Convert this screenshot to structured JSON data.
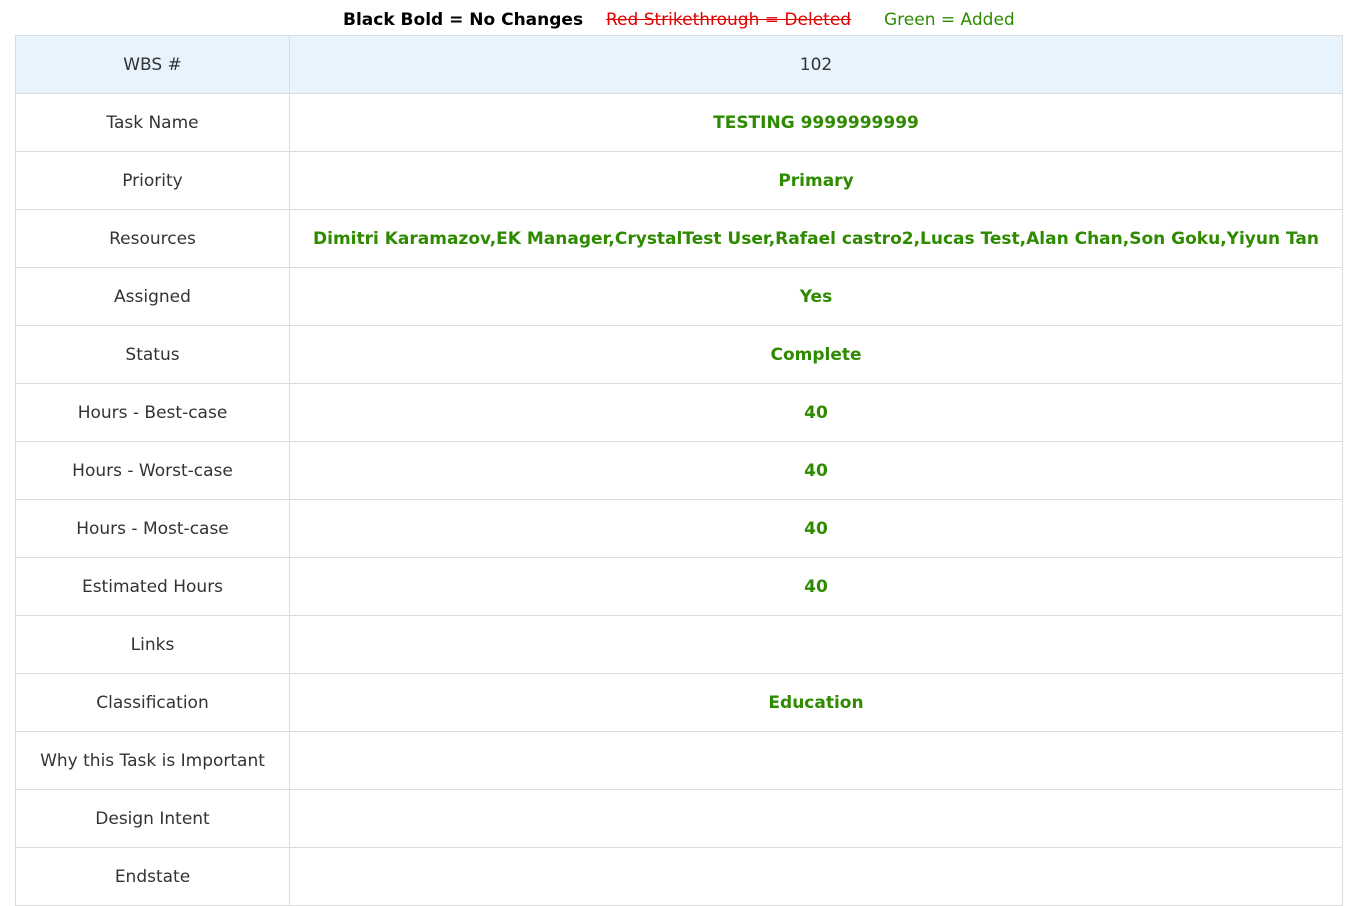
{
  "legend": {
    "no_changes": "Black Bold = No Changes",
    "deleted": "Red Strikethrough = Deleted",
    "added": "Green = Added"
  },
  "colors": {
    "added": "#2e8b00",
    "deleted": "#e00000",
    "header_bg": "#e8f4fd",
    "border": "#dcdcdc"
  },
  "rows": [
    {
      "label": "WBS #",
      "value": "102"
    },
    {
      "label": "Task Name",
      "value": "TESTING 9999999999"
    },
    {
      "label": "Priority",
      "value": "Primary"
    },
    {
      "label": "Resources",
      "value": "Dimitri Karamazov,EK Manager,CrystalTest User,Rafael castro2,Lucas Test,Alan Chan,Son Goku,Yiyun Tan"
    },
    {
      "label": "Assigned",
      "value": "Yes"
    },
    {
      "label": "Status",
      "value": "Complete"
    },
    {
      "label": "Hours - Best-case",
      "value": "40"
    },
    {
      "label": "Hours - Worst-case",
      "value": "40"
    },
    {
      "label": "Hours - Most-case",
      "value": "40"
    },
    {
      "label": "Estimated Hours",
      "value": "40"
    },
    {
      "label": "Links",
      "value": ""
    },
    {
      "label": "Classification",
      "value": "Education"
    },
    {
      "label": "Why this Task is Important",
      "value": ""
    },
    {
      "label": "Design Intent",
      "value": ""
    },
    {
      "label": "Endstate",
      "value": ""
    }
  ]
}
